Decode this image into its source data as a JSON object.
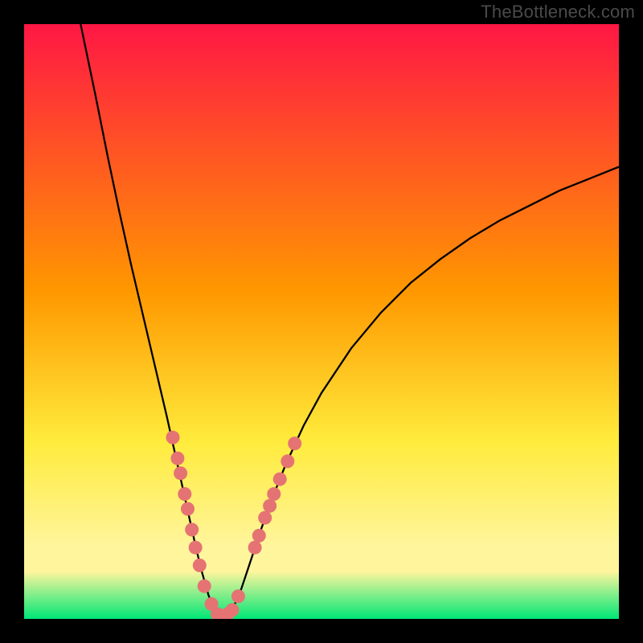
{
  "watermark": "TheBottleneck.com",
  "colors": {
    "frame_bg": "#000000",
    "curve_stroke": "#000000",
    "dot_fill": "#e57373",
    "grad_top": "#ff1744",
    "grad_mid1": "#ff9800",
    "grad_mid2": "#ffeb3b",
    "grad_band": "#fff59d",
    "grad_bottom": "#00e676"
  },
  "chart_data": {
    "type": "line",
    "title": "",
    "xlabel": "",
    "ylabel": "",
    "xlim": [
      0,
      100
    ],
    "ylim": [
      0,
      100
    ],
    "curve": [
      {
        "x": 9.5,
        "y": 100.0
      },
      {
        "x": 12.0,
        "y": 88.0
      },
      {
        "x": 14.0,
        "y": 78.0
      },
      {
        "x": 16.0,
        "y": 68.5
      },
      {
        "x": 18.0,
        "y": 59.5
      },
      {
        "x": 20.0,
        "y": 51.0
      },
      {
        "x": 22.0,
        "y": 42.5
      },
      {
        "x": 24.0,
        "y": 34.0
      },
      {
        "x": 25.0,
        "y": 29.5
      },
      {
        "x": 26.0,
        "y": 25.0
      },
      {
        "x": 27.0,
        "y": 20.5
      },
      {
        "x": 28.0,
        "y": 16.0
      },
      {
        "x": 29.0,
        "y": 11.5
      },
      {
        "x": 30.0,
        "y": 7.5
      },
      {
        "x": 31.0,
        "y": 4.0
      },
      {
        "x": 32.0,
        "y": 1.5
      },
      {
        "x": 33.0,
        "y": 0.5
      },
      {
        "x": 34.0,
        "y": 0.5
      },
      {
        "x": 35.0,
        "y": 1.5
      },
      {
        "x": 36.5,
        "y": 5.0
      },
      {
        "x": 38.0,
        "y": 9.5
      },
      {
        "x": 40.0,
        "y": 15.5
      },
      {
        "x": 42.0,
        "y": 21.0
      },
      {
        "x": 44.0,
        "y": 26.0
      },
      {
        "x": 47.0,
        "y": 32.5
      },
      {
        "x": 50.0,
        "y": 38.0
      },
      {
        "x": 55.0,
        "y": 45.5
      },
      {
        "x": 60.0,
        "y": 51.5
      },
      {
        "x": 65.0,
        "y": 56.5
      },
      {
        "x": 70.0,
        "y": 60.5
      },
      {
        "x": 75.0,
        "y": 64.0
      },
      {
        "x": 80.0,
        "y": 67.0
      },
      {
        "x": 85.0,
        "y": 69.5
      },
      {
        "x": 90.0,
        "y": 72.0
      },
      {
        "x": 95.0,
        "y": 74.0
      },
      {
        "x": 100.0,
        "y": 76.0
      }
    ],
    "dots": [
      {
        "x": 25.0,
        "y": 30.5
      },
      {
        "x": 25.8,
        "y": 27.0
      },
      {
        "x": 26.3,
        "y": 24.5
      },
      {
        "x": 27.0,
        "y": 21.0
      },
      {
        "x": 27.5,
        "y": 18.5
      },
      {
        "x": 28.2,
        "y": 15.0
      },
      {
        "x": 28.8,
        "y": 12.0
      },
      {
        "x": 29.5,
        "y": 9.0
      },
      {
        "x": 30.3,
        "y": 5.5
      },
      {
        "x": 31.5,
        "y": 2.5
      },
      {
        "x": 32.5,
        "y": 0.8
      },
      {
        "x": 33.3,
        "y": 0.5
      },
      {
        "x": 34.2,
        "y": 0.8
      },
      {
        "x": 35.0,
        "y": 1.5
      },
      {
        "x": 36.0,
        "y": 3.8
      },
      {
        "x": 38.8,
        "y": 12.0
      },
      {
        "x": 39.5,
        "y": 14.0
      },
      {
        "x": 40.5,
        "y": 17.0
      },
      {
        "x": 41.3,
        "y": 19.0
      },
      {
        "x": 42.0,
        "y": 21.0
      },
      {
        "x": 43.0,
        "y": 23.5
      },
      {
        "x": 44.3,
        "y": 26.5
      },
      {
        "x": 45.5,
        "y": 29.5
      }
    ]
  }
}
